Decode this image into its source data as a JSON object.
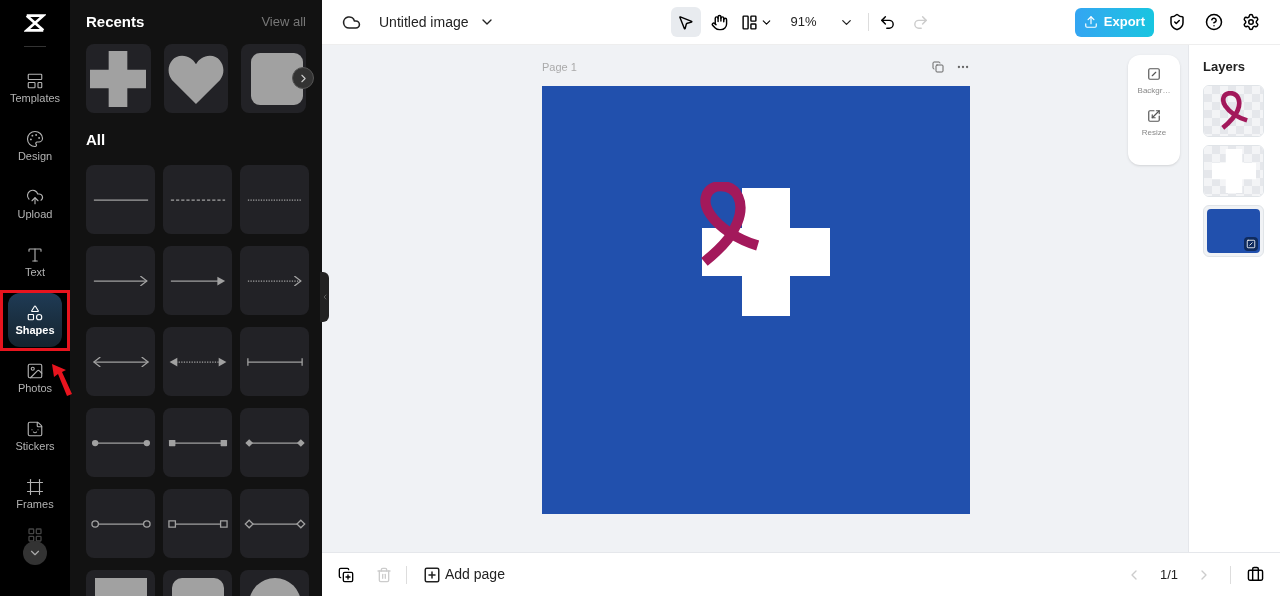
{
  "rail": {
    "items": [
      {
        "label": "Templates",
        "selected": false
      },
      {
        "label": "Design",
        "selected": false
      },
      {
        "label": "Upload",
        "selected": false
      },
      {
        "label": "Text",
        "selected": false
      },
      {
        "label": "Shapes",
        "selected": true
      },
      {
        "label": "Photos",
        "selected": false
      },
      {
        "label": "Stickers",
        "selected": false
      },
      {
        "label": "Frames",
        "selected": false
      }
    ]
  },
  "panel": {
    "recents_title": "Recents",
    "view_all": "View all",
    "recents": [
      {
        "kind": "cross"
      },
      {
        "kind": "heart"
      },
      {
        "kind": "rounded-square"
      }
    ],
    "all_title": "All",
    "shapes": [
      {
        "kind": "solid-line"
      },
      {
        "kind": "dashed-line"
      },
      {
        "kind": "dotted-line"
      },
      {
        "kind": "open-arrow"
      },
      {
        "kind": "solid-arrow"
      },
      {
        "kind": "dotted-arrow"
      },
      {
        "kind": "double-arrow"
      },
      {
        "kind": "dotted-double-arrow"
      },
      {
        "kind": "bar-ends"
      },
      {
        "kind": "dot-ends"
      },
      {
        "kind": "square-ends"
      },
      {
        "kind": "diamond-ends"
      },
      {
        "kind": "circle-outline-ends"
      },
      {
        "kind": "square-outline-ends"
      },
      {
        "kind": "diamond-outline-ends"
      },
      {
        "kind": "square"
      },
      {
        "kind": "rounded-square"
      },
      {
        "kind": "circle"
      }
    ]
  },
  "topbar": {
    "title": "Untitled image",
    "zoom": "91%",
    "export": "Export"
  },
  "canvas": {
    "page_label": "Page 1"
  },
  "float_tools": [
    {
      "label": "Backgr…"
    },
    {
      "label": "Resize"
    }
  ],
  "layers": {
    "title": "Layers",
    "items": [
      {
        "kind": "ribbon"
      },
      {
        "kind": "cross"
      },
      {
        "kind": "background"
      }
    ]
  },
  "bottombar": {
    "add_page": "Add page",
    "pager": "1/1"
  }
}
